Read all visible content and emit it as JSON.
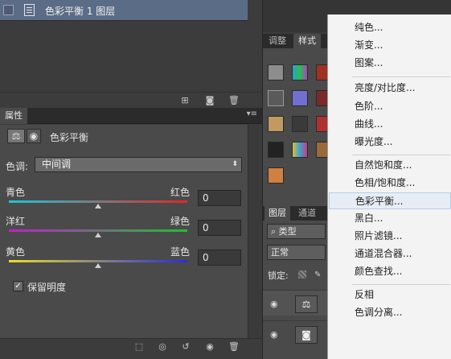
{
  "layer": {
    "name": "色彩平衡 1 图层"
  },
  "properties": {
    "tab_label": "属性",
    "panel_menu": "▾≡",
    "adjustment_title": "色彩平衡",
    "tone_label": "色调:",
    "tone_value": "中间调",
    "sliders": [
      {
        "left": "青色",
        "right": "红色",
        "value": "0",
        "colors": [
          "#19c8d4",
          "#e0282a"
        ]
      },
      {
        "left": "洋红",
        "right": "绿色",
        "value": "0",
        "colors": [
          "#c020c8",
          "#1fc030"
        ]
      },
      {
        "left": "黄色",
        "right": "蓝色",
        "value": "0",
        "colors": [
          "#e6e020",
          "#2b2be0"
        ]
      }
    ],
    "preserve_luminosity": {
      "label": "保留明度",
      "checked": true
    }
  },
  "styles_panel": {
    "tabs": [
      "调整",
      "样式"
    ],
    "active_tab": 1
  },
  "layers_panel": {
    "tabs": [
      "图层",
      "通道"
    ],
    "filter_label": "类型",
    "blend_mode": "正常",
    "lock_label": "锁定:"
  },
  "adjustment_menu": {
    "highlighted": "色彩平衡...",
    "groups": [
      [
        "纯色...",
        "渐变...",
        "图案..."
      ],
      [
        "亮度/对比度...",
        "色阶...",
        "曲线...",
        "曝光度..."
      ],
      [
        "自然饱和度...",
        "色相/饱和度...",
        "色彩平衡...",
        "黑白...",
        "照片滤镜...",
        "通道混合器...",
        "颜色查找..."
      ],
      [
        "反相",
        "色调分离..."
      ]
    ]
  }
}
